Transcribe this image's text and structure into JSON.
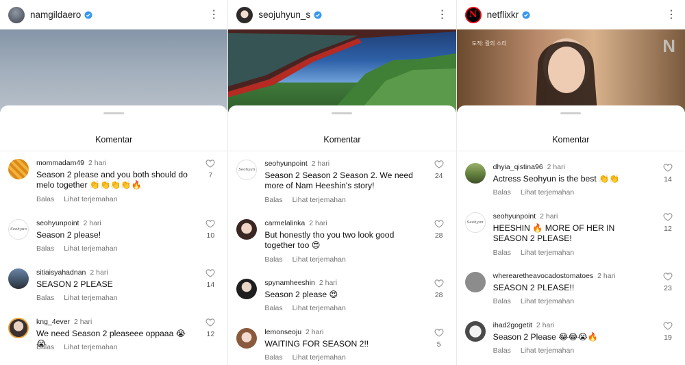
{
  "panels": [
    {
      "username": "namgildaero",
      "sheet_title": "Komentar",
      "comments": [
        {
          "user": "mommadam49",
          "time": "2 hari",
          "text": "Season 2 please and you both should do melo together 👏👏👏👏🔥",
          "reply": "Balas",
          "translate": "Lihat terjemahan",
          "likes": "7"
        },
        {
          "user": "seohyunpoint",
          "time": "2 hari",
          "text": "Season 2 please!",
          "reply": "Balas",
          "translate": "Lihat terjemahan",
          "likes": "10"
        },
        {
          "user": "sitiaisyahadnan",
          "time": "2 hari",
          "text": "SEASON 2 PLEASE",
          "reply": "Balas",
          "translate": "Lihat terjemahan",
          "likes": "14"
        },
        {
          "user": "kng_4ever",
          "time": "2 hari",
          "text": "We need Season 2  pleaseee oppaaa 😭😭",
          "reply": "Balas",
          "translate": "Lihat terjemahan",
          "likes": "12"
        }
      ]
    },
    {
      "username": "seojuhyun_s",
      "sheet_title": "Komentar",
      "comments": [
        {
          "user": "seohyunpoint",
          "time": "2 hari",
          "text": "Season 2 Season 2 Season 2. We need more of Nam Heeshin's story!",
          "reply": "Balas",
          "translate": "Lihat terjemahan",
          "likes": "24"
        },
        {
          "user": "carmelalinka",
          "time": "2 hari",
          "text": "But honestly tho you two look good together too 😍",
          "reply": "Balas",
          "translate": "Lihat terjemahan",
          "likes": "28"
        },
        {
          "user": "spynamheeshin",
          "time": "2 hari",
          "text": "Season 2 please 😍",
          "reply": "Balas",
          "translate": "Lihat terjemahan",
          "likes": "28"
        },
        {
          "user": "lemonseoju",
          "time": "2 hari",
          "text": "WAITING FOR SEASON 2!!",
          "reply": "Balas",
          "translate": "Lihat terjemahan",
          "likes": "5"
        }
      ]
    },
    {
      "username": "netflixkr",
      "media_caption": "도적: 칼의 소리",
      "sheet_title": "Komentar",
      "comments": [
        {
          "user": "dhyia_qistina96",
          "time": "2 hari",
          "text": "Actress Seohyun is the best 👏👏",
          "reply": "Balas",
          "translate": "Lihat terjemahan",
          "likes": "14"
        },
        {
          "user": "seohyunpoint",
          "time": "2 hari",
          "text": "HEESHIN 🔥 MORE OF HER IN SEASON 2 PLEASE!",
          "reply": "Balas",
          "translate": "Lihat terjemahan",
          "likes": "12"
        },
        {
          "user": "wherearetheavocadostomatoes",
          "time": "2 hari",
          "text": "SEASON 2 PLEASE!!",
          "reply": "Balas",
          "translate": "Lihat terjemahan",
          "likes": "23"
        },
        {
          "user": "ihad2gogetit",
          "time": "2 hari",
          "text": "Season 2 Please 😂😂😭🔥",
          "reply": "Balas",
          "translate": "Lihat terjemahan",
          "likes": "19"
        }
      ]
    }
  ],
  "colors": {
    "verified": "#3897f0",
    "netflix": "#e50914",
    "muted": "#737373"
  }
}
